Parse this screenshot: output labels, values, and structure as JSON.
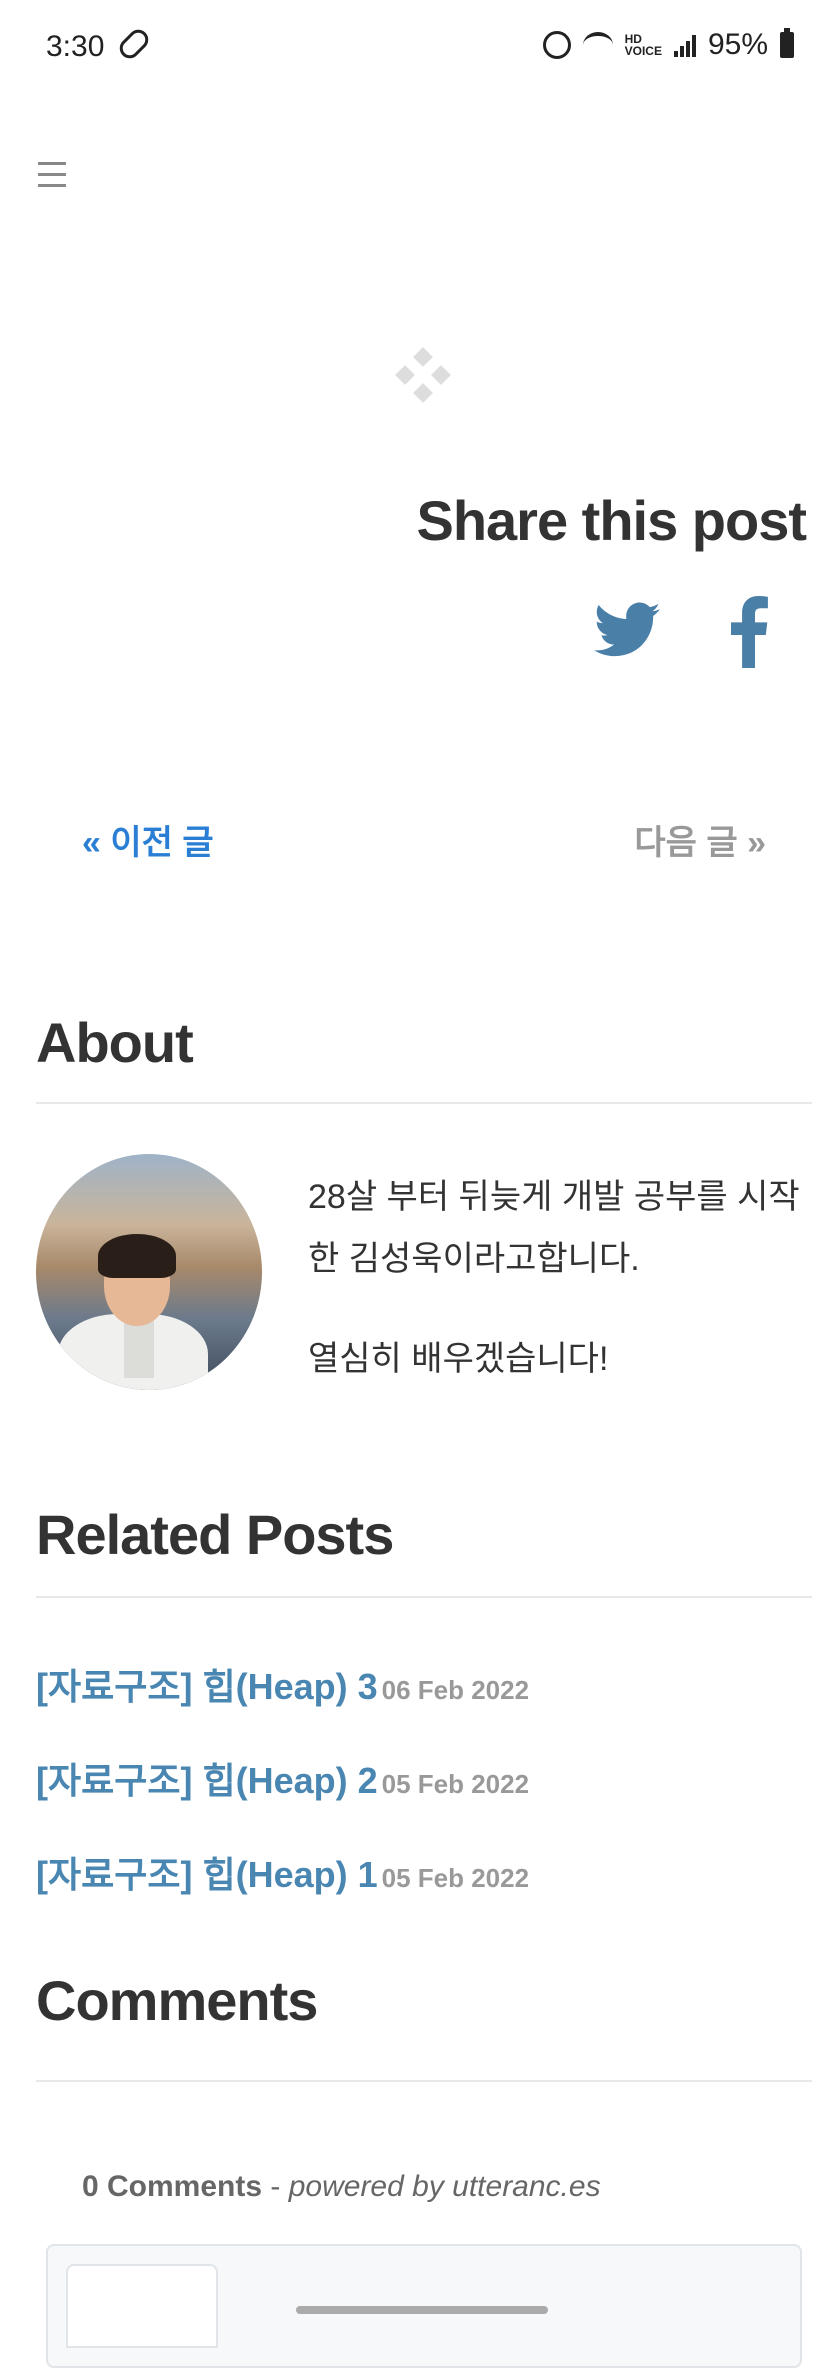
{
  "status": {
    "time": "3:30",
    "battery": "95%"
  },
  "share": {
    "title": "Share this post"
  },
  "pager": {
    "prev": "« 이전 글",
    "next": "다음 글 »"
  },
  "about": {
    "title": "About",
    "paragraphs": [
      "28살 부터 뒤늦게 개발 공부를 시작한 김성욱이라고합니다.",
      "열심히 배우겠습니다!"
    ]
  },
  "related": {
    "title": "Related Posts",
    "items": [
      {
        "title": "[자료구조] 힙(Heap) 3",
        "date": "06 Feb 2022"
      },
      {
        "title": "[자료구조] 힙(Heap) 2",
        "date": "05 Feb 2022"
      },
      {
        "title": "[자료구조] 힙(Heap) 1",
        "date": "05 Feb 2022"
      }
    ]
  },
  "comments": {
    "title": "Comments",
    "count": "0 Comments",
    "separator": " - ",
    "powered": "powered by utteranc.es"
  },
  "colors": {
    "link": "#2a7fd4",
    "related_link": "#4a86b2",
    "social": "#4a7fa8",
    "muted": "#999999"
  },
  "icons": [
    "pill-icon",
    "alarm-icon",
    "wifi-icon",
    "signal-icon",
    "battery-icon",
    "menu-icon",
    "loader-icon",
    "twitter-icon",
    "facebook-icon"
  ]
}
